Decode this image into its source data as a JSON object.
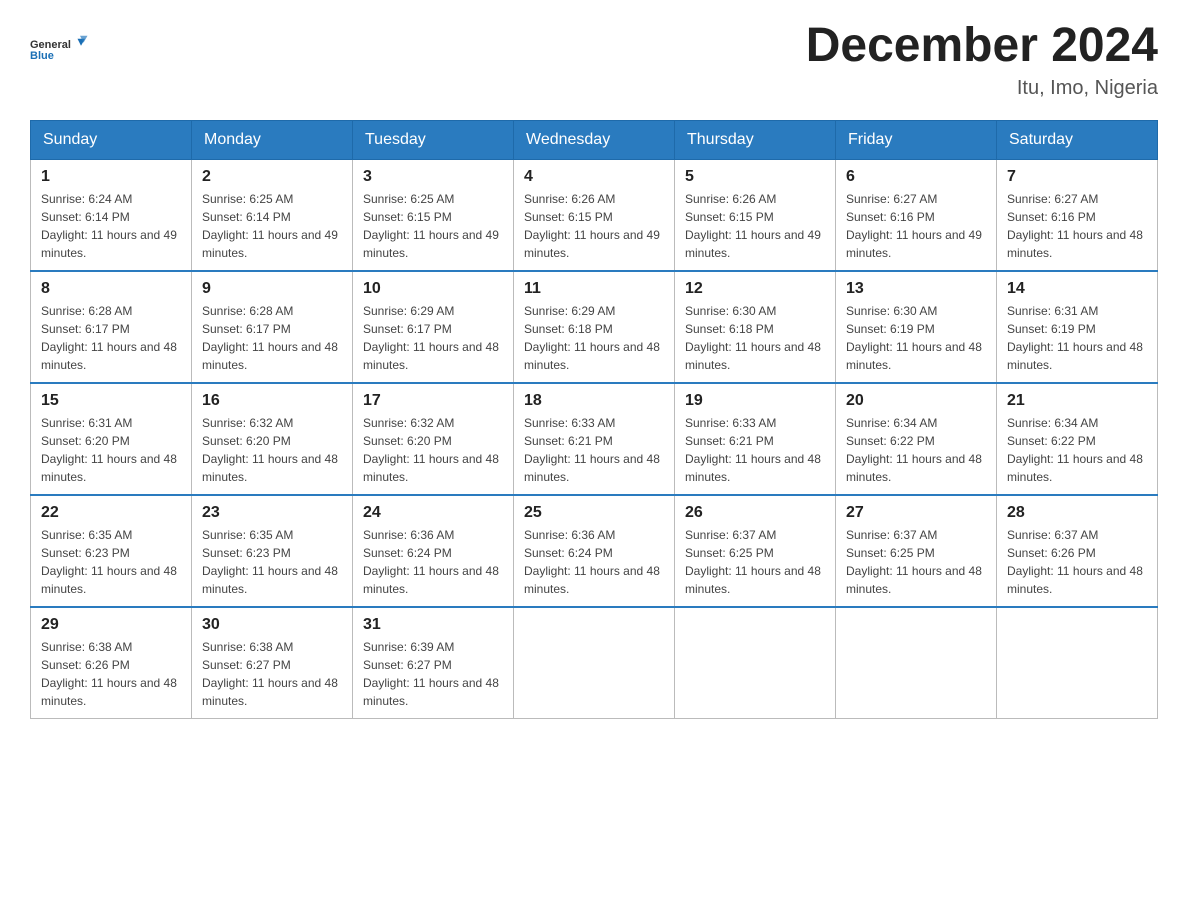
{
  "header": {
    "logo_general": "General",
    "logo_blue": "Blue",
    "month_title": "December 2024",
    "location": "Itu, Imo, Nigeria"
  },
  "calendar": {
    "days_of_week": [
      "Sunday",
      "Monday",
      "Tuesday",
      "Wednesday",
      "Thursday",
      "Friday",
      "Saturday"
    ],
    "weeks": [
      [
        {
          "day": "1",
          "sunrise": "6:24 AM",
          "sunset": "6:14 PM",
          "daylight": "11 hours and 49 minutes."
        },
        {
          "day": "2",
          "sunrise": "6:25 AM",
          "sunset": "6:14 PM",
          "daylight": "11 hours and 49 minutes."
        },
        {
          "day": "3",
          "sunrise": "6:25 AM",
          "sunset": "6:15 PM",
          "daylight": "11 hours and 49 minutes."
        },
        {
          "day": "4",
          "sunrise": "6:26 AM",
          "sunset": "6:15 PM",
          "daylight": "11 hours and 49 minutes."
        },
        {
          "day": "5",
          "sunrise": "6:26 AM",
          "sunset": "6:15 PM",
          "daylight": "11 hours and 49 minutes."
        },
        {
          "day": "6",
          "sunrise": "6:27 AM",
          "sunset": "6:16 PM",
          "daylight": "11 hours and 49 minutes."
        },
        {
          "day": "7",
          "sunrise": "6:27 AM",
          "sunset": "6:16 PM",
          "daylight": "11 hours and 48 minutes."
        }
      ],
      [
        {
          "day": "8",
          "sunrise": "6:28 AM",
          "sunset": "6:17 PM",
          "daylight": "11 hours and 48 minutes."
        },
        {
          "day": "9",
          "sunrise": "6:28 AM",
          "sunset": "6:17 PM",
          "daylight": "11 hours and 48 minutes."
        },
        {
          "day": "10",
          "sunrise": "6:29 AM",
          "sunset": "6:17 PM",
          "daylight": "11 hours and 48 minutes."
        },
        {
          "day": "11",
          "sunrise": "6:29 AM",
          "sunset": "6:18 PM",
          "daylight": "11 hours and 48 minutes."
        },
        {
          "day": "12",
          "sunrise": "6:30 AM",
          "sunset": "6:18 PM",
          "daylight": "11 hours and 48 minutes."
        },
        {
          "day": "13",
          "sunrise": "6:30 AM",
          "sunset": "6:19 PM",
          "daylight": "11 hours and 48 minutes."
        },
        {
          "day": "14",
          "sunrise": "6:31 AM",
          "sunset": "6:19 PM",
          "daylight": "11 hours and 48 minutes."
        }
      ],
      [
        {
          "day": "15",
          "sunrise": "6:31 AM",
          "sunset": "6:20 PM",
          "daylight": "11 hours and 48 minutes."
        },
        {
          "day": "16",
          "sunrise": "6:32 AM",
          "sunset": "6:20 PM",
          "daylight": "11 hours and 48 minutes."
        },
        {
          "day": "17",
          "sunrise": "6:32 AM",
          "sunset": "6:20 PM",
          "daylight": "11 hours and 48 minutes."
        },
        {
          "day": "18",
          "sunrise": "6:33 AM",
          "sunset": "6:21 PM",
          "daylight": "11 hours and 48 minutes."
        },
        {
          "day": "19",
          "sunrise": "6:33 AM",
          "sunset": "6:21 PM",
          "daylight": "11 hours and 48 minutes."
        },
        {
          "day": "20",
          "sunrise": "6:34 AM",
          "sunset": "6:22 PM",
          "daylight": "11 hours and 48 minutes."
        },
        {
          "day": "21",
          "sunrise": "6:34 AM",
          "sunset": "6:22 PM",
          "daylight": "11 hours and 48 minutes."
        }
      ],
      [
        {
          "day": "22",
          "sunrise": "6:35 AM",
          "sunset": "6:23 PM",
          "daylight": "11 hours and 48 minutes."
        },
        {
          "day": "23",
          "sunrise": "6:35 AM",
          "sunset": "6:23 PM",
          "daylight": "11 hours and 48 minutes."
        },
        {
          "day": "24",
          "sunrise": "6:36 AM",
          "sunset": "6:24 PM",
          "daylight": "11 hours and 48 minutes."
        },
        {
          "day": "25",
          "sunrise": "6:36 AM",
          "sunset": "6:24 PM",
          "daylight": "11 hours and 48 minutes."
        },
        {
          "day": "26",
          "sunrise": "6:37 AM",
          "sunset": "6:25 PM",
          "daylight": "11 hours and 48 minutes."
        },
        {
          "day": "27",
          "sunrise": "6:37 AM",
          "sunset": "6:25 PM",
          "daylight": "11 hours and 48 minutes."
        },
        {
          "day": "28",
          "sunrise": "6:37 AM",
          "sunset": "6:26 PM",
          "daylight": "11 hours and 48 minutes."
        }
      ],
      [
        {
          "day": "29",
          "sunrise": "6:38 AM",
          "sunset": "6:26 PM",
          "daylight": "11 hours and 48 minutes."
        },
        {
          "day": "30",
          "sunrise": "6:38 AM",
          "sunset": "6:27 PM",
          "daylight": "11 hours and 48 minutes."
        },
        {
          "day": "31",
          "sunrise": "6:39 AM",
          "sunset": "6:27 PM",
          "daylight": "11 hours and 48 minutes."
        },
        null,
        null,
        null,
        null
      ]
    ]
  }
}
